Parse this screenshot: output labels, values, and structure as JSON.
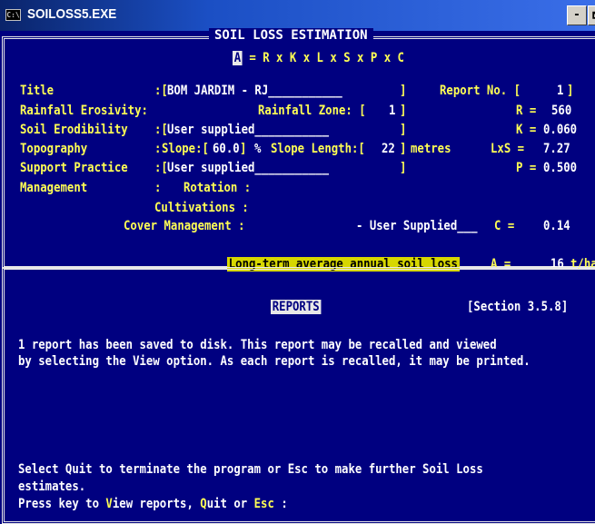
{
  "window": {
    "title": "SOILOSS5.EXE",
    "icon_name": "console-icon",
    "icon_glyph": "C:\\",
    "minimize_label": "-",
    "maximize_label": "🗗"
  },
  "estimation": {
    "header": "SOIL LOSS ESTIMATION",
    "equation_a": "A",
    "equation_rest": " = R x K x L x S x P x C",
    "title_label": "Title",
    "title_value": "BOM JARDIM - RJ___________",
    "report_no_label": "Report No. [",
    "report_no_value": "1",
    "rainfall_label": "Rainfall Erosivity:",
    "rainfall_zone_label": "Rainfall Zone: [",
    "rainfall_zone_value": "1",
    "r_label": "R =",
    "r_value": "560",
    "erodibility_label": "Soil Erodibility",
    "erodibility_value": "User supplied___________",
    "k_label": "K =",
    "k_value": "0.060",
    "topography_label": "Topography",
    "slope_label": "Slope:[",
    "slope_value": "60.0",
    "slope_unit": "%",
    "slope_length_label": "Slope Length:[",
    "slope_length_value": "22",
    "slope_length_unit": "metres",
    "ls_label": "LxS =",
    "ls_value": "7.27",
    "support_label": "Support Practice",
    "support_value": "User supplied___________",
    "p_label": "P =",
    "p_value": "0.500",
    "management_label": "Management",
    "rotation_label": "Rotation :",
    "cultivations_label": "Cultivations :",
    "cover_label": "Cover Management :",
    "cover_value": "- User Supplied___",
    "c_label": "C =",
    "c_value": "0.14",
    "result_label": "Long-term average annual soil loss",
    "a_label": "A =",
    "a_value": "16",
    "a_unit": "t/ha"
  },
  "reports": {
    "header": "REPORTS",
    "section": "[Section 3.5.8]",
    "message_line1": "1 report has been saved to disk. This report may be recalled and viewed",
    "message_line2": "by selecting the View option. As each report is recalled, it may be printed.",
    "quit_line1": "Select Quit to terminate the program or Esc to make further Soil Loss",
    "quit_line2": "estimates.",
    "prompt_prefix": "Press key to ",
    "view_key": "V",
    "view_rest": "iew reports, ",
    "quit_key": "Q",
    "quit_rest": "uit or ",
    "esc_key": "Esc",
    "prompt_suffix": " :"
  },
  "colors": {
    "background": "#000080",
    "label": "#ffff54",
    "value": "#ffffff",
    "highlight": "#d7d700"
  }
}
